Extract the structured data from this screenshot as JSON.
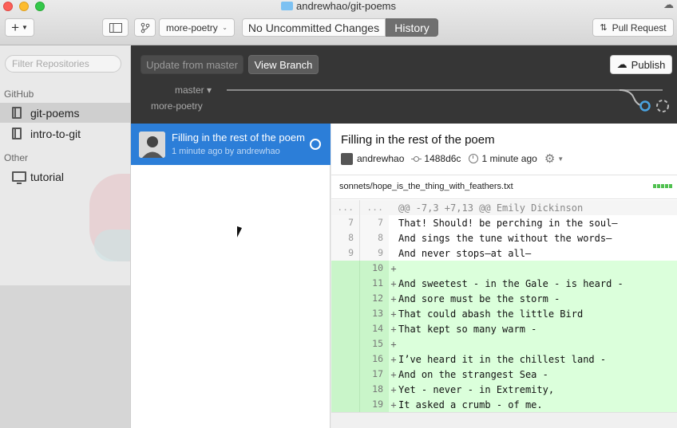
{
  "window": {
    "title": "andrewhao/git-poems"
  },
  "toolbar": {
    "add_label": "+",
    "branch_select": "more-poetry",
    "uncommitted_label": "No Uncommitted Changes",
    "history_label": "History",
    "pull_request_label": "Pull Request"
  },
  "sidebar": {
    "filter_placeholder": "Filter Repositories",
    "sections": [
      {
        "label": "GitHub",
        "items": [
          {
            "label": "git-poems",
            "selected": true
          },
          {
            "label": "intro-to-git"
          }
        ]
      },
      {
        "label": "Other",
        "items": [
          {
            "label": "tutorial"
          }
        ]
      }
    ]
  },
  "branch_header": {
    "update_label": "Update from master",
    "view_branch_label": "View Branch",
    "publish_label": "Publish",
    "master_label": "master ▾",
    "branch_label": "more-poetry"
  },
  "commits": [
    {
      "title": "Filling in the rest of the poem",
      "meta": "1 minute ago by andrewhao"
    }
  ],
  "detail": {
    "title": "Filling in the rest of the poem",
    "author": "andrewhao",
    "sha": "1488d6c",
    "time": "1 minute ago",
    "file_path": "sonnets/hope_is_the_thing_with_feathers.txt",
    "hunk_old": "...",
    "hunk_new": "...",
    "hunk_header": "@@ -7,3 +7,13 @@ Emily Dickinson",
    "lines": [
      {
        "type": "ctx",
        "old": "7",
        "new": "7",
        "sign": "",
        "text": "That! Should! be perching in the soul—"
      },
      {
        "type": "ctx",
        "old": "8",
        "new": "8",
        "sign": "",
        "text": "And sings the tune without the words—"
      },
      {
        "type": "ctx",
        "old": "9",
        "new": "9",
        "sign": "",
        "text": "And never stops—at all—"
      },
      {
        "type": "add",
        "old": "",
        "new": "10",
        "sign": "+",
        "text": ""
      },
      {
        "type": "add",
        "old": "",
        "new": "11",
        "sign": "+",
        "text": "And sweetest - in the Gale - is heard -"
      },
      {
        "type": "add",
        "old": "",
        "new": "12",
        "sign": "+",
        "text": "And sore must be the storm -"
      },
      {
        "type": "add",
        "old": "",
        "new": "13",
        "sign": "+",
        "text": "That could abash the little Bird"
      },
      {
        "type": "add",
        "old": "",
        "new": "14",
        "sign": "+",
        "text": "That kept so many warm -"
      },
      {
        "type": "add",
        "old": "",
        "new": "15",
        "sign": "+",
        "text": ""
      },
      {
        "type": "add",
        "old": "",
        "new": "16",
        "sign": "+",
        "text": "I’ve heard it in the chillest land -"
      },
      {
        "type": "add",
        "old": "",
        "new": "17",
        "sign": "+",
        "text": "And on the strangest Sea -"
      },
      {
        "type": "add",
        "old": "",
        "new": "18",
        "sign": "+",
        "text": "Yet - never - in Extremity,"
      },
      {
        "type": "add",
        "old": "",
        "new": "19",
        "sign": "+",
        "text": "It asked a crumb - of me."
      }
    ]
  },
  "colors": {
    "accent": "#2c7ed8",
    "dark_header": "#363636",
    "add_bg": "#dbffdb",
    "graph": "#4aa3e0"
  }
}
